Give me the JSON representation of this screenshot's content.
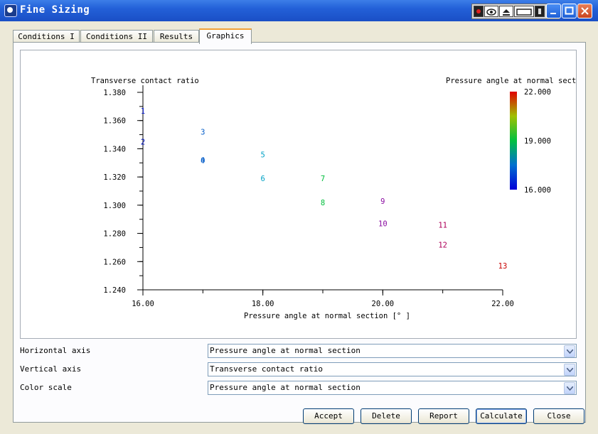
{
  "window": {
    "title": "Fine Sizing"
  },
  "tabs": [
    {
      "label": "Conditions I",
      "active": false
    },
    {
      "label": "Conditions II",
      "active": false
    },
    {
      "label": "Results",
      "active": false
    },
    {
      "label": "Graphics",
      "active": true
    }
  ],
  "chart_data": {
    "type": "scatter",
    "ylabel": "Transverse contact ratio",
    "xlabel": "Pressure angle at normal section [° ]",
    "xlim": [
      16.0,
      22.0
    ],
    "ylim": [
      1.24,
      1.38
    ],
    "x_ticks": [
      "16.00",
      "18.00",
      "20.00",
      "22.00"
    ],
    "y_ticks": [
      "1.380",
      "1.360",
      "1.340",
      "1.320",
      "1.300",
      "1.280",
      "1.260",
      "1.240"
    ],
    "points": [
      {
        "label": "1",
        "x": 16.0,
        "y": 1.367
      },
      {
        "label": "2",
        "x": 16.0,
        "y": 1.345
      },
      {
        "label": "3",
        "x": 17.0,
        "y": 1.352
      },
      {
        "label": "4",
        "x": 17.0,
        "y": 1.332
      },
      {
        "label": "0",
        "x": 17.0,
        "y": 1.332
      },
      {
        "label": "5",
        "x": 18.0,
        "y": 1.336
      },
      {
        "label": "6",
        "x": 18.0,
        "y": 1.319
      },
      {
        "label": "7",
        "x": 19.0,
        "y": 1.319
      },
      {
        "label": "8",
        "x": 19.0,
        "y": 1.302
      },
      {
        "label": "9",
        "x": 20.0,
        "y": 1.303
      },
      {
        "label": "10",
        "x": 20.0,
        "y": 1.287
      },
      {
        "label": "11",
        "x": 21.0,
        "y": 1.286
      },
      {
        "label": "12",
        "x": 21.0,
        "y": 1.272
      },
      {
        "label": "13",
        "x": 22.0,
        "y": 1.257
      }
    ],
    "color_scale": {
      "title": "Pressure angle at normal section",
      "min_label": "16.000",
      "mid_label": "19.000",
      "max_label": "22.000",
      "min": 16.0,
      "max": 22.0
    }
  },
  "controls": {
    "horizontal": {
      "label": "Horizontal axis",
      "value": "Pressure angle at normal section"
    },
    "vertical": {
      "label": "Vertical axis",
      "value": "Transverse contact ratio"
    },
    "color": {
      "label": "Color scale",
      "value": "Pressure angle at normal section"
    }
  },
  "buttons": {
    "accept": "Accept",
    "delete": "Delete",
    "report": "Report",
    "calculate": "Calculate",
    "close": "Close"
  },
  "icons": {
    "app": "app-icon",
    "minimize": "minimize-icon",
    "maximize": "maximize-icon",
    "close": "close-icon",
    "dropdown": "chevron-down-icon"
  }
}
